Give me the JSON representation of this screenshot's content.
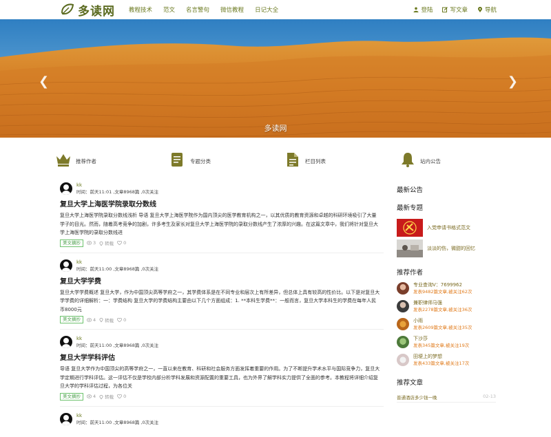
{
  "header": {
    "logo_text": "多读网",
    "nav": [
      "教程技术",
      "范文",
      "名言警句",
      "微信教程",
      "日记大全"
    ],
    "login": "登陆",
    "write": "写文章",
    "guide": "导航"
  },
  "banner": {
    "caption": "多读网"
  },
  "features": [
    "推荐作者",
    "专题分类",
    "栏目列表",
    "站内公告"
  ],
  "posts": [
    {
      "author": "kk",
      "time": "时间：前天11:01 ,文章8968篇 ,0次关注",
      "title": "复旦大学上海医学院录取分数线",
      "excerpt": "复旦大学上海医学院录取分数线浅析 导语 复旦大学上海医学院作为国内顶尖的医学教育机构之一，以其优质的教育资源和卓越的科研环境吸引了大量学子的目光。然而，随着高考竞争的加剧，许多考生及家长对复旦大学上海医学院的录取分数线产生了浓厚的兴趣。在这篇文章中，我们将针对复旦大学上海医学院的录取分数线进",
      "tag": "美文摘抄",
      "views": "3",
      "likes": "0"
    },
    {
      "author": "kk",
      "time": "时间：前天11:00 ,文章8968篇 ,0次关注",
      "title": "复旦大学学费",
      "excerpt": "复旦大学学费概述 复旦大学，作为中国顶尖高等学府之一，其学费体系是在不同专业和层次上有所差异，但总体上具有较高的性价比。以下是对复旦大学学费的详细解析：一：学费结构 复旦大学的学费结构主要由以下几个方面组成：1. **本科生学费**：一般而言，复旦大学本科生的学费在每年人民币8000元",
      "tag": "美文摘抄",
      "views": "4",
      "likes": "0"
    },
    {
      "author": "kk",
      "time": "时间：前天11:00 ,文章8968篇 ,0次关注",
      "title": "复旦大学学科评估",
      "excerpt": "导语 复旦大学作为中国顶尖的高等学府之一，一直以来在教育、科研和社会服务方面发挥着重要的作用。为了不断提升学术水平与国际竞争力，复旦大学定期进行学科评估。这一评估不仅是学校内部分析学科发展和资源配置的重要工具，也为外界了解学科实力提供了全面的参考。本教程将详细介绍复旦大学的学科评估过程，为各位关",
      "tag": "美文摘抄",
      "views": "4",
      "likes": "0"
    },
    {
      "author": "kk",
      "time": "时间：前天11:00 ,文章8968篇 ,0次关注"
    }
  ],
  "sidebar": {
    "announce_title": "最新公告",
    "topics_title": "最新专题",
    "topics": [
      "入党申请书格式范文",
      "淡淡的伤，微甜的回忆"
    ],
    "authors_title": "推荐作者",
    "authors": [
      {
        "name": "专业查询V：7699962",
        "stats": "发表9482篇文章,被关注62次"
      },
      {
        "name": "兼职律师马强",
        "stats": "发表2278篇文章,被关注36次"
      },
      {
        "name": "小雨",
        "stats": "发表2609篇文章,被关注35次"
      },
      {
        "name": "下沙莎",
        "stats": "发表345篇文章,被关注19次"
      },
      {
        "name": "田埂上的梦想",
        "stats": "发表433篇文章,被关注17次"
      }
    ],
    "rec_title": "推荐文章",
    "rec": [
      {
        "title": "普通酒店多少钱一晚",
        "date": "02-13"
      }
    ]
  },
  "colors": {
    "accent": "#6b7a20",
    "orange": "#e07a1a",
    "tag_green": "#4a9e4a"
  }
}
